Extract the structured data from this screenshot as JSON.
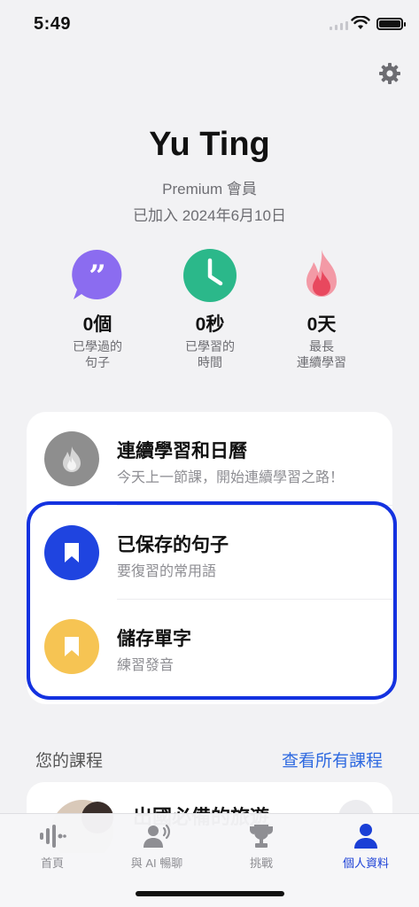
{
  "status_bar": {
    "time": "5:49"
  },
  "profile": {
    "name": "Yu Ting",
    "membership": "Premium 會員",
    "joined": "已加入 2024年6月10日"
  },
  "stats": [
    {
      "icon": "quote-bubble-icon",
      "value": "0個",
      "label_line1": "已學過的",
      "label_line2": "句子",
      "color": "#8b6cf0"
    },
    {
      "icon": "clock-icon",
      "value": "0秒",
      "label_line1": "已學習的",
      "label_line2": "時間",
      "color": "#2bb88a"
    },
    {
      "icon": "flame-icon",
      "value": "0天",
      "label_line1": "最長",
      "label_line2": "連續學習",
      "color": "#f07a8a"
    }
  ],
  "menu": [
    {
      "title": "連續學習和日曆",
      "subtitle": "今天上一節課，開始連續學習之路！",
      "icon": "flame-icon",
      "color": "#8e8e8e"
    },
    {
      "title": "已保存的句子",
      "subtitle": "要復習的常用語",
      "icon": "bookmark-icon",
      "color": "#1f44e0"
    },
    {
      "title": "儲存單字",
      "subtitle": "練習發音",
      "icon": "bookmark-icon",
      "color": "#f6c453"
    }
  ],
  "courses": {
    "section_title": "您的課程",
    "view_all": "查看所有課程",
    "first_course_title": "出國必備的旅遊"
  },
  "tab_bar": [
    {
      "label": "首頁",
      "icon": "waveform-icon",
      "active": false
    },
    {
      "label": "與 AI 暢聊",
      "icon": "voice-chat-icon",
      "active": false
    },
    {
      "label": "挑戰",
      "icon": "trophy-icon",
      "active": false
    },
    {
      "label": "個人資料",
      "icon": "person-icon",
      "active": true
    }
  ],
  "colors": {
    "accent": "#1f44e0",
    "highlight_border": "#1432e0",
    "link": "#2f6ae0"
  }
}
